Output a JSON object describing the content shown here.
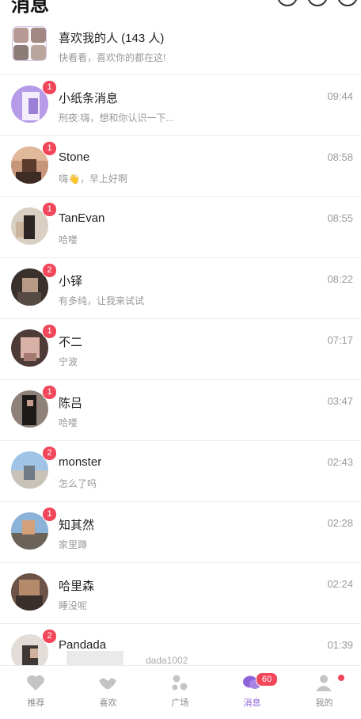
{
  "header": {
    "title": "消息"
  },
  "likes_row": {
    "title": "喜欢我的人 (143 人)",
    "subtitle": "快看看，喜欢你的都在这!"
  },
  "conversations": [
    {
      "name": "小纸条消息",
      "preview": "刑夜:嗨，想和你认识一下...",
      "time": "09:44",
      "badge": "1"
    },
    {
      "name": "Stone",
      "preview": "嗨👋，早上好啊",
      "time": "08:58",
      "badge": "1"
    },
    {
      "name": "TanEvan",
      "preview": "哈喽",
      "time": "08:55",
      "badge": "1"
    },
    {
      "name": "小铎",
      "preview": "有多纯，让我来试试",
      "time": "08:22",
      "badge": "2"
    },
    {
      "name": "不二",
      "preview": "宁波",
      "time": "07:17",
      "badge": "1"
    },
    {
      "name": "陈吕",
      "preview": "哈喽",
      "time": "03:47",
      "badge": "1"
    },
    {
      "name": "monster",
      "preview": "怎么了吗",
      "time": "02:43",
      "badge": "2"
    },
    {
      "name": "知其然",
      "preview": "家里蹲",
      "time": "02:28",
      "badge": "1"
    },
    {
      "name": "哈里森",
      "preview": "睡没呢",
      "time": "02:24",
      "badge": ""
    },
    {
      "name": "Pandada",
      "preview": "",
      "time": "01:39",
      "badge": "2"
    }
  ],
  "partial_text": "dada1002",
  "tabbar": {
    "tabs": [
      {
        "label": "推荐",
        "icon": "heart-icon"
      },
      {
        "label": "喜欢",
        "icon": "handshake-icon"
      },
      {
        "label": "广场",
        "icon": "square-dots-icon"
      },
      {
        "label": "消息",
        "icon": "chat-bubbles-icon",
        "badge": "60"
      },
      {
        "label": "我的",
        "icon": "person-icon"
      }
    ]
  },
  "colors": {
    "accent": "#8e62d9",
    "badge": "#f2475a",
    "inactive": "#c4c4c4"
  }
}
